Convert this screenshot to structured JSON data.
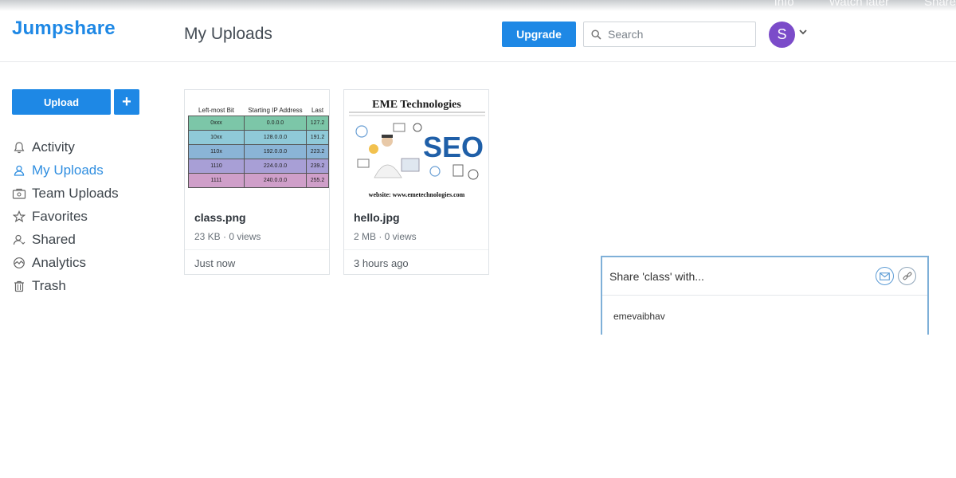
{
  "overlay": {
    "links": [
      "Info",
      "Watch later",
      "Share"
    ]
  },
  "header": {
    "logo": "Jumpshare",
    "title": "My Uploads",
    "upgrade_label": "Upgrade",
    "search_placeholder": "Search",
    "avatar_initial": "S"
  },
  "sidebar": {
    "upload_label": "Upload",
    "plus_label": "+",
    "items": [
      {
        "label": "Activity",
        "icon": "bell-icon",
        "active": false
      },
      {
        "label": "My Uploads",
        "icon": "user-icon",
        "active": true
      },
      {
        "label": "Team Uploads",
        "icon": "team-icon",
        "active": false
      },
      {
        "label": "Favorites",
        "icon": "star-icon",
        "active": false
      },
      {
        "label": "Shared",
        "icon": "shared-user-icon",
        "active": false
      },
      {
        "label": "Analytics",
        "icon": "analytics-icon",
        "active": false
      },
      {
        "label": "Trash",
        "icon": "trash-icon",
        "active": false
      }
    ]
  },
  "files": [
    {
      "name": "class.png",
      "meta": "23 KB · 0 views",
      "time": "Just now",
      "thumb_table": {
        "headers": [
          "Left-most Bit",
          "Starting IP Address",
          "Last"
        ],
        "rows": [
          [
            "0xxx",
            "0.0.0.0",
            "127.2"
          ],
          [
            "10xx",
            "128.0.0.0",
            "191.2"
          ],
          [
            "110x",
            "192.0.0.0",
            "223.2"
          ],
          [
            "1110",
            "224.0.0.0",
            "239.2"
          ],
          [
            "1111",
            "240.0.0.0",
            "255.2"
          ]
        ],
        "row_colors": [
          "#7cc6a8",
          "#8fc9d8",
          "#8ab4d6",
          "#a89fd6",
          "#cf9fc9"
        ]
      }
    },
    {
      "name": "hello.jpg",
      "meta": "2 MB · 0 views",
      "time": "3 hours ago",
      "thumb_title": "EME Technologies",
      "thumb_big": "SEO",
      "thumb_footer": "website: www.emetechnologies.com"
    }
  ],
  "share": {
    "title": "Share 'class' with...",
    "user": "emevaibhav"
  },
  "colors": {
    "accent": "#1e88e5",
    "avatar": "#7b4bc9",
    "active_nav": "#2f8ee0"
  }
}
